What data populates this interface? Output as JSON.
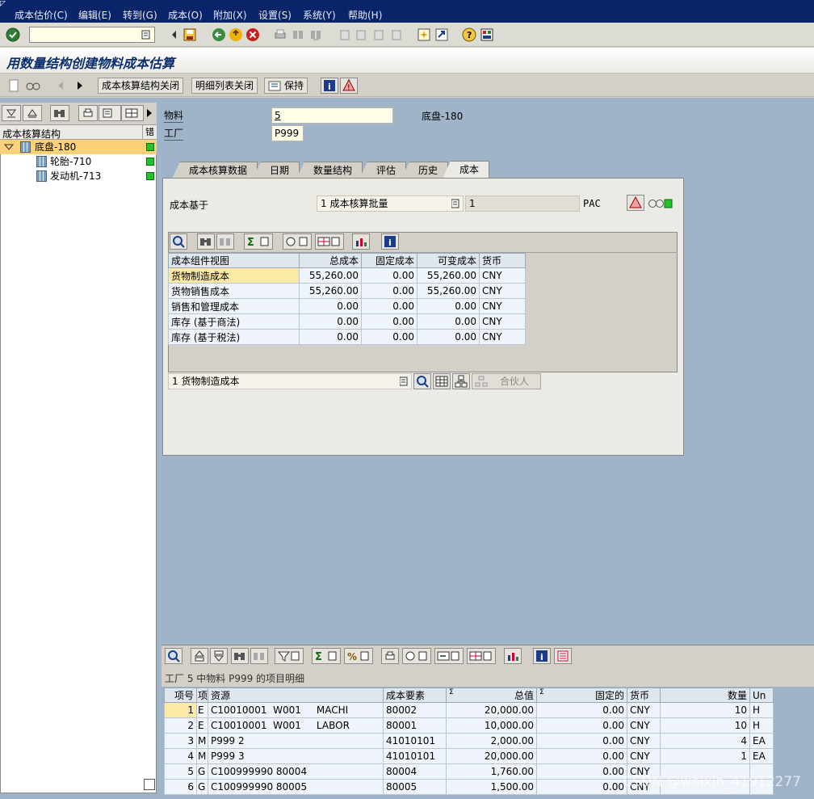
{
  "menubar": {
    "items": [
      "成本估价(C)",
      "编辑(E)",
      "转到(G)",
      "成本(O)",
      "附加(X)",
      "设置(S)",
      "系统(Y)",
      "帮助(H)"
    ]
  },
  "systoolbar": {
    "command_value": ""
  },
  "title": "用数量结构创建物料成本估算",
  "apptoolbar": {
    "btn_structure_close": "成本核算结构关闭",
    "btn_detail_close": "明细列表关闭",
    "btn_keep": "保持"
  },
  "tree": {
    "col_structure": "成本核算结构",
    "col_status": "错",
    "items": [
      {
        "label": "底盘-180"
      },
      {
        "label": "轮胎-710"
      },
      {
        "label": "发动机-713"
      }
    ]
  },
  "header": {
    "material_label": "物料",
    "material_value": "5",
    "material_desc": "底盘-180",
    "plant_label": "工厂",
    "plant_value": "P999"
  },
  "tabs": [
    "成本核算数据",
    "日期",
    "数量结构",
    "评估",
    "历史",
    "成本"
  ],
  "cost_panel": {
    "basis_label": "成本基于",
    "basis_value": "1 成本核算批量",
    "lot_value": "1",
    "currency_code": "PAC",
    "columns": [
      "成本组件视图",
      "总成本",
      "固定成本",
      "可变成本",
      "货币"
    ],
    "rows": [
      [
        "货物制造成本",
        "55,260.00",
        "0.00",
        "55,260.00",
        "CNY"
      ],
      [
        "货物销售成本",
        "55,260.00",
        "0.00",
        "55,260.00",
        "CNY"
      ],
      [
        "销售和管理成本",
        "0.00",
        "0.00",
        "0.00",
        "CNY"
      ],
      [
        "库存 (基于商法)",
        "0.00",
        "0.00",
        "0.00",
        "CNY"
      ],
      [
        "库存 (基于税法)",
        "0.00",
        "0.00",
        "0.00",
        "CNY"
      ]
    ],
    "view_select": "1 货物制造成本",
    "partner_label": "合伙人"
  },
  "itemization": {
    "caption": "工厂 5 中物料 P999 的项目明细",
    "columns": [
      "项号",
      "项",
      "资源",
      "成本要素",
      "总值",
      "固定的",
      "货币",
      "数量",
      "Un"
    ],
    "sum_marker": "Σ",
    "rows": [
      [
        "1",
        "E",
        "C10010001  W001     MACHI",
        "80002",
        "20,000.00",
        "0.00",
        "CNY",
        "10",
        "H"
      ],
      [
        "2",
        "E",
        "C10010001  W001     LABOR",
        "80001",
        "10,000.00",
        "0.00",
        "CNY",
        "10",
        "H"
      ],
      [
        "3",
        "M",
        "P999 2",
        "41010101",
        "2,000.00",
        "0.00",
        "CNY",
        "4",
        "EA"
      ],
      [
        "4",
        "M",
        "P999 3",
        "41010101",
        "20,000.00",
        "0.00",
        "CNY",
        "1",
        "EA"
      ],
      [
        "5",
        "G",
        "C100999990 80004",
        "80004",
        "1,760.00",
        "0.00",
        "CNY",
        "",
        ""
      ],
      [
        "6",
        "G",
        "C100999990 80005",
        "80005",
        "1,500.00",
        "0.00",
        "CNY",
        "",
        ""
      ]
    ]
  },
  "watermark": "CSDN @weixin_41912277"
}
